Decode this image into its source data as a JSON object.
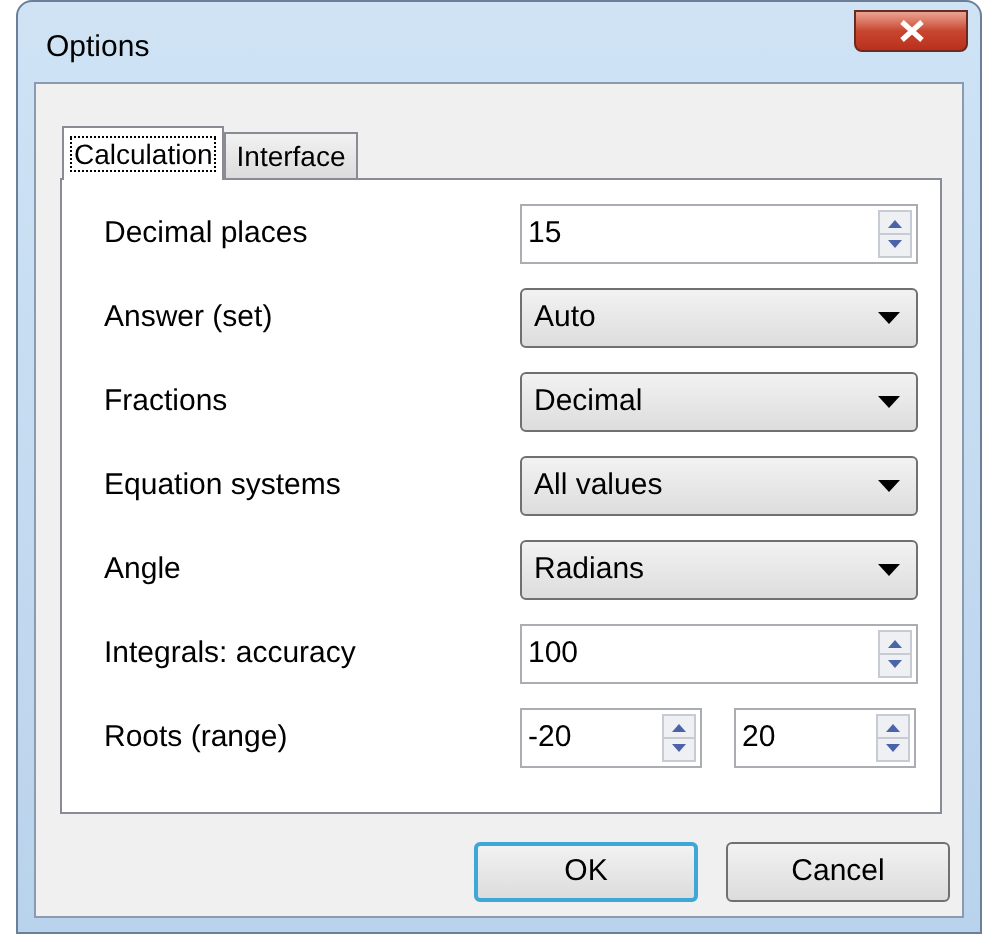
{
  "window": {
    "title": "Options"
  },
  "tabs": [
    {
      "label": "Calculation",
      "selected": true
    },
    {
      "label": "Interface",
      "selected": false
    }
  ],
  "settings": [
    {
      "kind": "spin",
      "label": "Decimal places",
      "value": "15"
    },
    {
      "kind": "dropdown",
      "label": "Answer (set)",
      "value": "Auto"
    },
    {
      "kind": "dropdown",
      "label": "Fractions",
      "value": "Decimal"
    },
    {
      "kind": "dropdown",
      "label": "Equation systems",
      "value": "All values"
    },
    {
      "kind": "dropdown",
      "label": "Angle",
      "value": "Radians"
    },
    {
      "kind": "spin",
      "label": "Integrals: accuracy",
      "value": "100"
    },
    {
      "kind": "spin_pair",
      "label": "Roots (range)",
      "values": [
        "-20",
        "20"
      ]
    }
  ],
  "buttons": [
    {
      "label": "OK",
      "default": true
    },
    {
      "label": "Cancel",
      "default": false
    }
  ]
}
